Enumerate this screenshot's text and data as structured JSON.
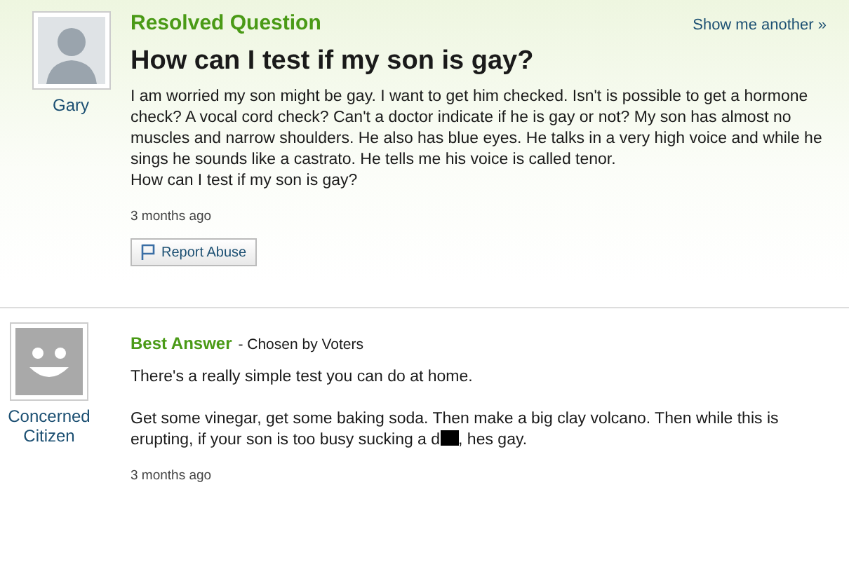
{
  "question": {
    "heading": "Resolved Question",
    "show_another": "Show me another »",
    "title": "How can I test if my son is gay?",
    "asker": "Gary",
    "body": [
      "I am worried my son might be gay. I want to get him checked. Isn't is possible to get a hormone check? A vocal cord check? Can't a doctor indicate if he is gay or not? My son has almost no muscles and narrow shoulders. He also has blue eyes. He talks in a very high voice and while he sings he sounds like a castrato. He tells me his voice is called tenor.",
      "How can I test if my son is gay?"
    ],
    "time": "3 months ago",
    "report": "Report Abuse"
  },
  "answer": {
    "heading": "Best Answer",
    "chosen": "- Chosen by Voters",
    "answerer": "Concerned Citizen",
    "intro": "There's a really simple test you can do at home.",
    "before_censor": "Get some vinegar, get some baking soda. Then make a big clay volcano. Then while this is erupting, if your son is too busy sucking a d",
    "censored": true,
    "after_censor": ", hes gay.",
    "time": "3 months ago"
  }
}
